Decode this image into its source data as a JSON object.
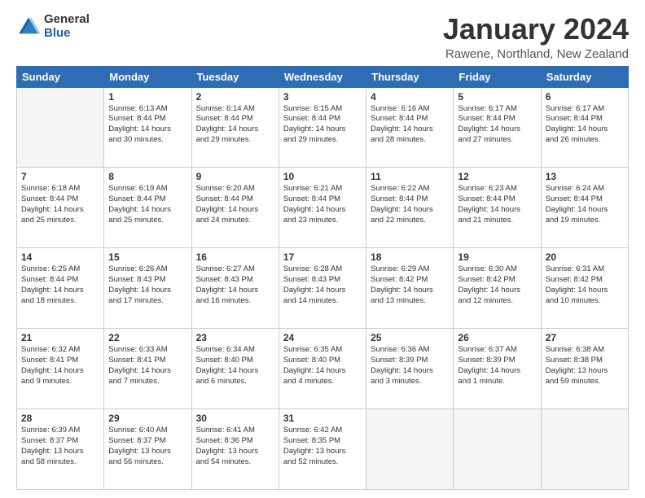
{
  "header": {
    "logo_general": "General",
    "logo_blue": "Blue",
    "month_title": "January 2024",
    "location": "Rawene, Northland, New Zealand"
  },
  "weekdays": [
    "Sunday",
    "Monday",
    "Tuesday",
    "Wednesday",
    "Thursday",
    "Friday",
    "Saturday"
  ],
  "weeks": [
    [
      {
        "day": "",
        "info": ""
      },
      {
        "day": "1",
        "info": "Sunrise: 6:13 AM\nSunset: 8:44 PM\nDaylight: 14 hours\nand 30 minutes."
      },
      {
        "day": "2",
        "info": "Sunrise: 6:14 AM\nSunset: 8:44 PM\nDaylight: 14 hours\nand 29 minutes."
      },
      {
        "day": "3",
        "info": "Sunrise: 6:15 AM\nSunset: 8:44 PM\nDaylight: 14 hours\nand 29 minutes."
      },
      {
        "day": "4",
        "info": "Sunrise: 6:16 AM\nSunset: 8:44 PM\nDaylight: 14 hours\nand 28 minutes."
      },
      {
        "day": "5",
        "info": "Sunrise: 6:17 AM\nSunset: 8:44 PM\nDaylight: 14 hours\nand 27 minutes."
      },
      {
        "day": "6",
        "info": "Sunrise: 6:17 AM\nSunset: 8:44 PM\nDaylight: 14 hours\nand 26 minutes."
      }
    ],
    [
      {
        "day": "7",
        "info": "Sunrise: 6:18 AM\nSunset: 8:44 PM\nDaylight: 14 hours\nand 25 minutes."
      },
      {
        "day": "8",
        "info": "Sunrise: 6:19 AM\nSunset: 8:44 PM\nDaylight: 14 hours\nand 25 minutes."
      },
      {
        "day": "9",
        "info": "Sunrise: 6:20 AM\nSunset: 8:44 PM\nDaylight: 14 hours\nand 24 minutes."
      },
      {
        "day": "10",
        "info": "Sunrise: 6:21 AM\nSunset: 8:44 PM\nDaylight: 14 hours\nand 23 minutes."
      },
      {
        "day": "11",
        "info": "Sunrise: 6:22 AM\nSunset: 8:44 PM\nDaylight: 14 hours\nand 22 minutes."
      },
      {
        "day": "12",
        "info": "Sunrise: 6:23 AM\nSunset: 8:44 PM\nDaylight: 14 hours\nand 21 minutes."
      },
      {
        "day": "13",
        "info": "Sunrise: 6:24 AM\nSunset: 8:44 PM\nDaylight: 14 hours\nand 19 minutes."
      }
    ],
    [
      {
        "day": "14",
        "info": "Sunrise: 6:25 AM\nSunset: 8:44 PM\nDaylight: 14 hours\nand 18 minutes."
      },
      {
        "day": "15",
        "info": "Sunrise: 6:26 AM\nSunset: 8:43 PM\nDaylight: 14 hours\nand 17 minutes."
      },
      {
        "day": "16",
        "info": "Sunrise: 6:27 AM\nSunset: 8:43 PM\nDaylight: 14 hours\nand 16 minutes."
      },
      {
        "day": "17",
        "info": "Sunrise: 6:28 AM\nSunset: 8:43 PM\nDaylight: 14 hours\nand 14 minutes."
      },
      {
        "day": "18",
        "info": "Sunrise: 6:29 AM\nSunset: 8:42 PM\nDaylight: 14 hours\nand 13 minutes."
      },
      {
        "day": "19",
        "info": "Sunrise: 6:30 AM\nSunset: 8:42 PM\nDaylight: 14 hours\nand 12 minutes."
      },
      {
        "day": "20",
        "info": "Sunrise: 6:31 AM\nSunset: 8:42 PM\nDaylight: 14 hours\nand 10 minutes."
      }
    ],
    [
      {
        "day": "21",
        "info": "Sunrise: 6:32 AM\nSunset: 8:41 PM\nDaylight: 14 hours\nand 9 minutes."
      },
      {
        "day": "22",
        "info": "Sunrise: 6:33 AM\nSunset: 8:41 PM\nDaylight: 14 hours\nand 7 minutes."
      },
      {
        "day": "23",
        "info": "Sunrise: 6:34 AM\nSunset: 8:40 PM\nDaylight: 14 hours\nand 6 minutes."
      },
      {
        "day": "24",
        "info": "Sunrise: 6:35 AM\nSunset: 8:40 PM\nDaylight: 14 hours\nand 4 minutes."
      },
      {
        "day": "25",
        "info": "Sunrise: 6:36 AM\nSunset: 8:39 PM\nDaylight: 14 hours\nand 3 minutes."
      },
      {
        "day": "26",
        "info": "Sunrise: 6:37 AM\nSunset: 8:39 PM\nDaylight: 14 hours\nand 1 minute."
      },
      {
        "day": "27",
        "info": "Sunrise: 6:38 AM\nSunset: 8:38 PM\nDaylight: 13 hours\nand 59 minutes."
      }
    ],
    [
      {
        "day": "28",
        "info": "Sunrise: 6:39 AM\nSunset: 8:37 PM\nDaylight: 13 hours\nand 58 minutes."
      },
      {
        "day": "29",
        "info": "Sunrise: 6:40 AM\nSunset: 8:37 PM\nDaylight: 13 hours\nand 56 minutes."
      },
      {
        "day": "30",
        "info": "Sunrise: 6:41 AM\nSunset: 8:36 PM\nDaylight: 13 hours\nand 54 minutes."
      },
      {
        "day": "31",
        "info": "Sunrise: 6:42 AM\nSunset: 8:35 PM\nDaylight: 13 hours\nand 52 minutes."
      },
      {
        "day": "",
        "info": ""
      },
      {
        "day": "",
        "info": ""
      },
      {
        "day": "",
        "info": ""
      }
    ]
  ]
}
